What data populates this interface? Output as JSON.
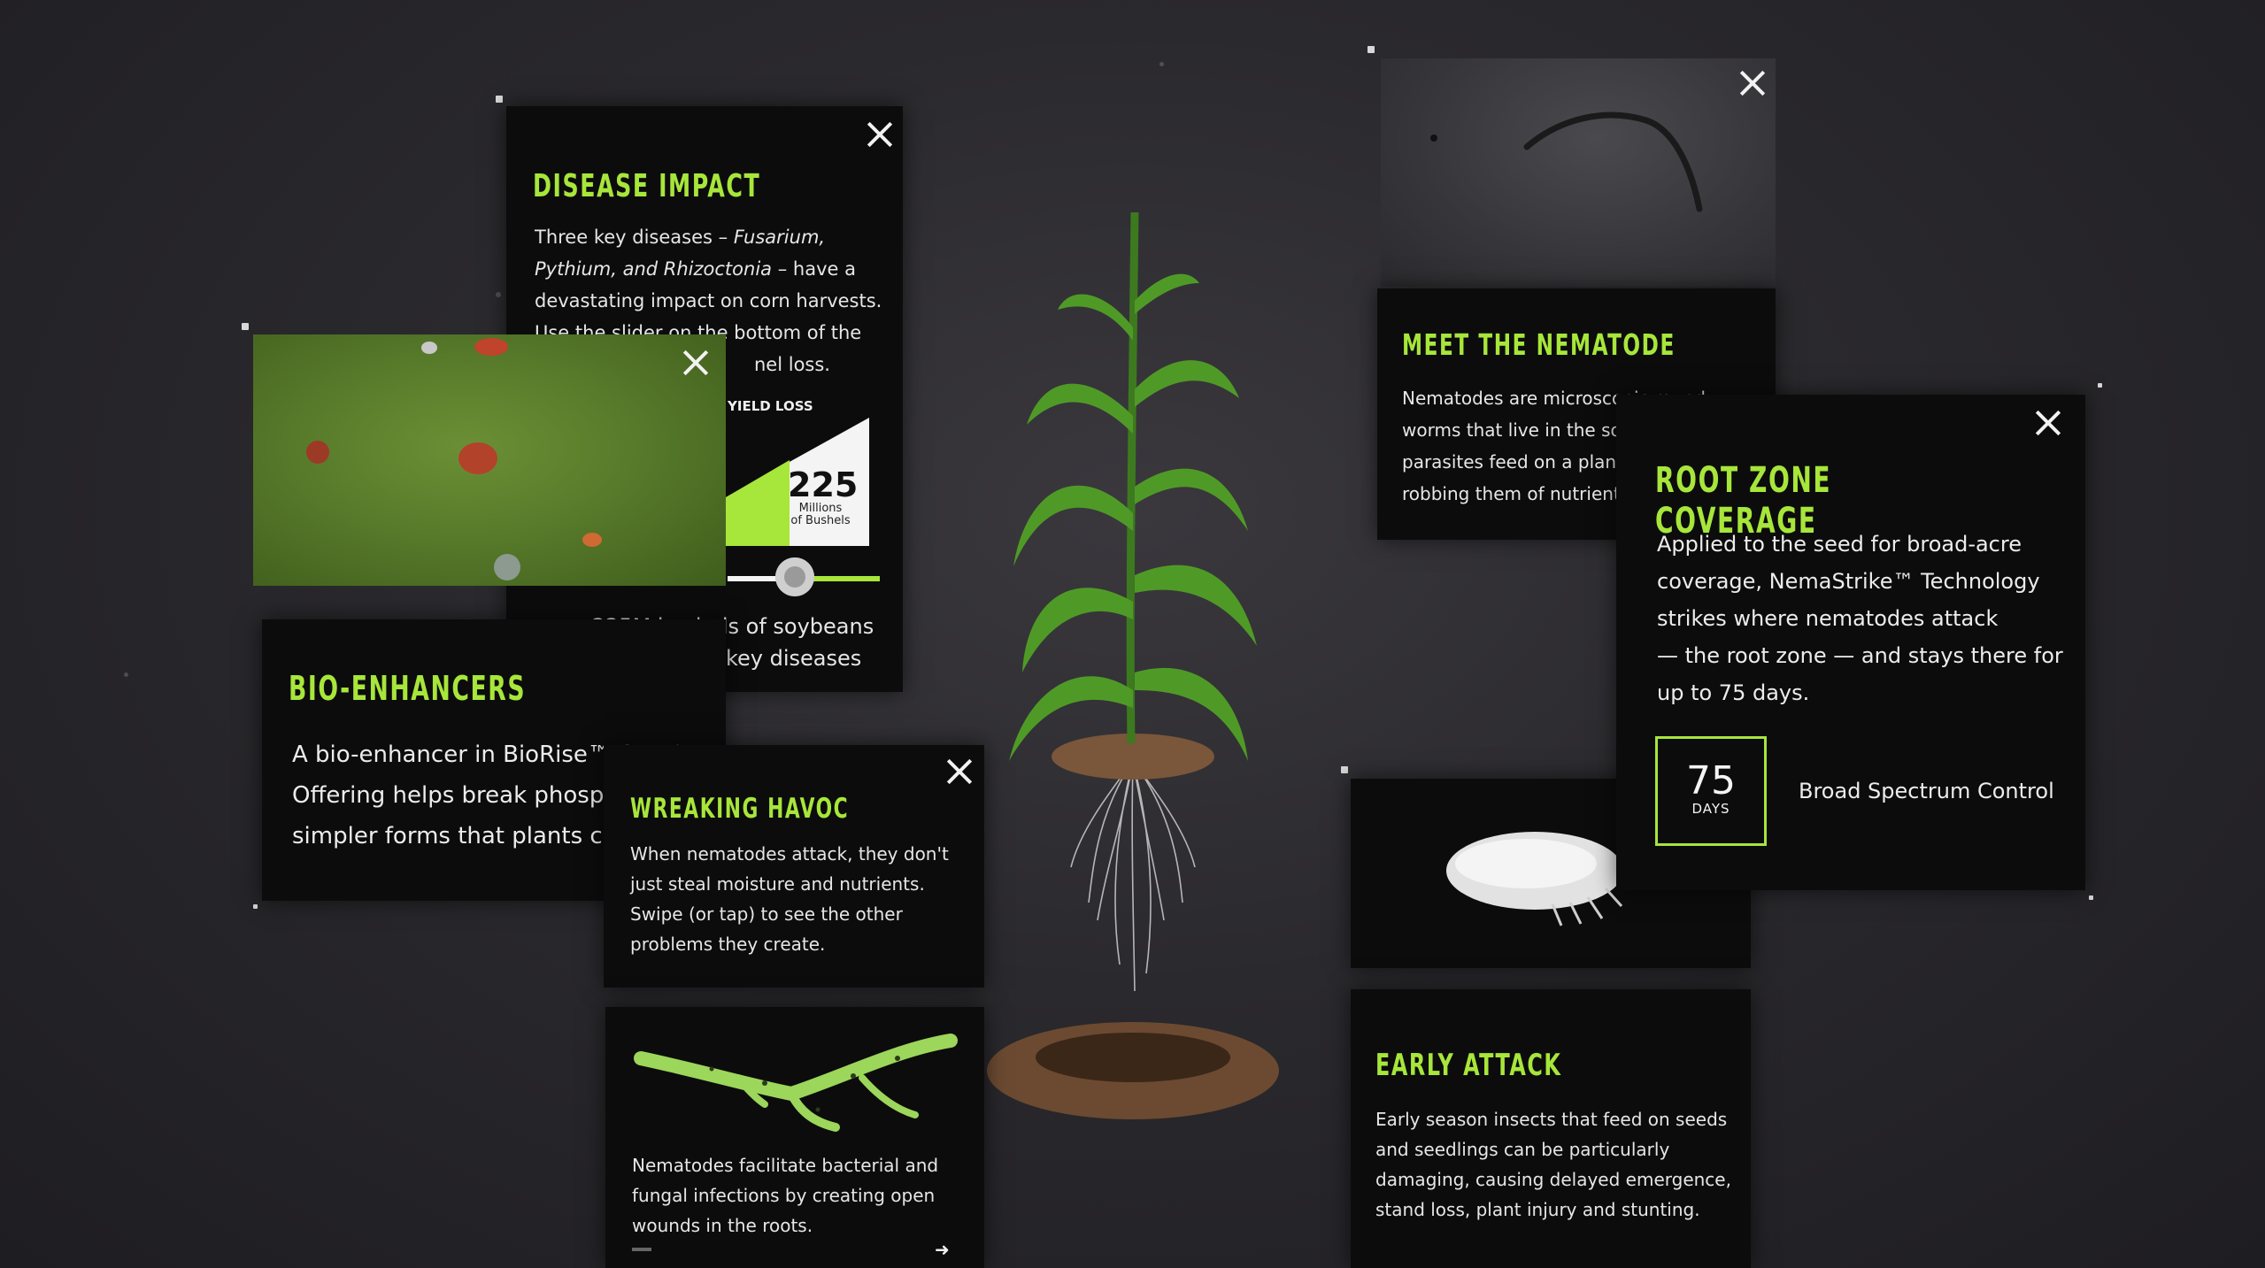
{
  "disease_impact": {
    "title": "DISEASE IMPACT",
    "body_1": "Three key diseases –",
    "body_italic_1": "Fusarium,",
    "body_italic_2": "Pythium, and Rhizoctonia",
    "body_2": "– have a",
    "body_3": "devastating impact on corn harvests.",
    "body_4": "Use the slider on the bottom of the",
    "body_5": "nel loss.",
    "yield_label": "YIELD LOSS",
    "yield_value": "225",
    "yield_unit_1": "Millions",
    "yield_unit_2": "of Bushels",
    "slider_level": 0.4,
    "caption_1": "225M bushels of soybeans",
    "caption_2": "lost from 3 key diseases"
  },
  "bio_enhancers": {
    "title": "BIO-ENHANCERS",
    "line_1": "A bio-enhancer in BioRise™ Corn*",
    "line_2": "Offering helps break phosphate into",
    "line_3": "simpler forms that plants can use."
  },
  "havoc": {
    "title": "WREAKING HAVOC",
    "line_1": "When nematodes attack, they don't",
    "line_2": "just steal moisture and nutrients.",
    "line_3": "Swipe (or tap) to see the other",
    "line_4": "problems they create."
  },
  "root_wounds": {
    "line_1": "Nematodes facilitate bacterial and",
    "line_2": "fungal infections by creating open",
    "line_3": "wounds in the roots."
  },
  "nematode": {
    "title": "MEET THE NEMATODE",
    "line_1": "Nematodes are microscopic round",
    "line_2": "worms that live in the soil. These",
    "line_3": "parasites feed on a plant's roots,",
    "line_4": "robbing them of nutrients and water."
  },
  "root_zone": {
    "title": "ROOT ZONE COVERAGE",
    "line_1": "Applied to the seed for broad-acre",
    "line_2": "coverage, NemaStrike™ Technology",
    "line_3": "strikes where nematodes attack",
    "line_4": "— the root zone — and stays there for",
    "line_5": "up to 75 days.",
    "days_value": "75",
    "days_label": "DAYS",
    "control_label": "Broad Spectrum Control"
  },
  "early_attack": {
    "title": "EARLY ATTACK",
    "line_1": "Early season insects that feed on seeds",
    "line_2": "and seedlings can be particularly",
    "line_3": "damaging, causing delayed emergence,",
    "line_4": "stand loss, plant injury and stunting."
  },
  "colors": {
    "accent": "#a7e63a",
    "panel": "#0c0c0d",
    "background": "#2a292d"
  },
  "icons": [
    "close-icon",
    "arrow-left-icon",
    "arrow-right-icon"
  ]
}
